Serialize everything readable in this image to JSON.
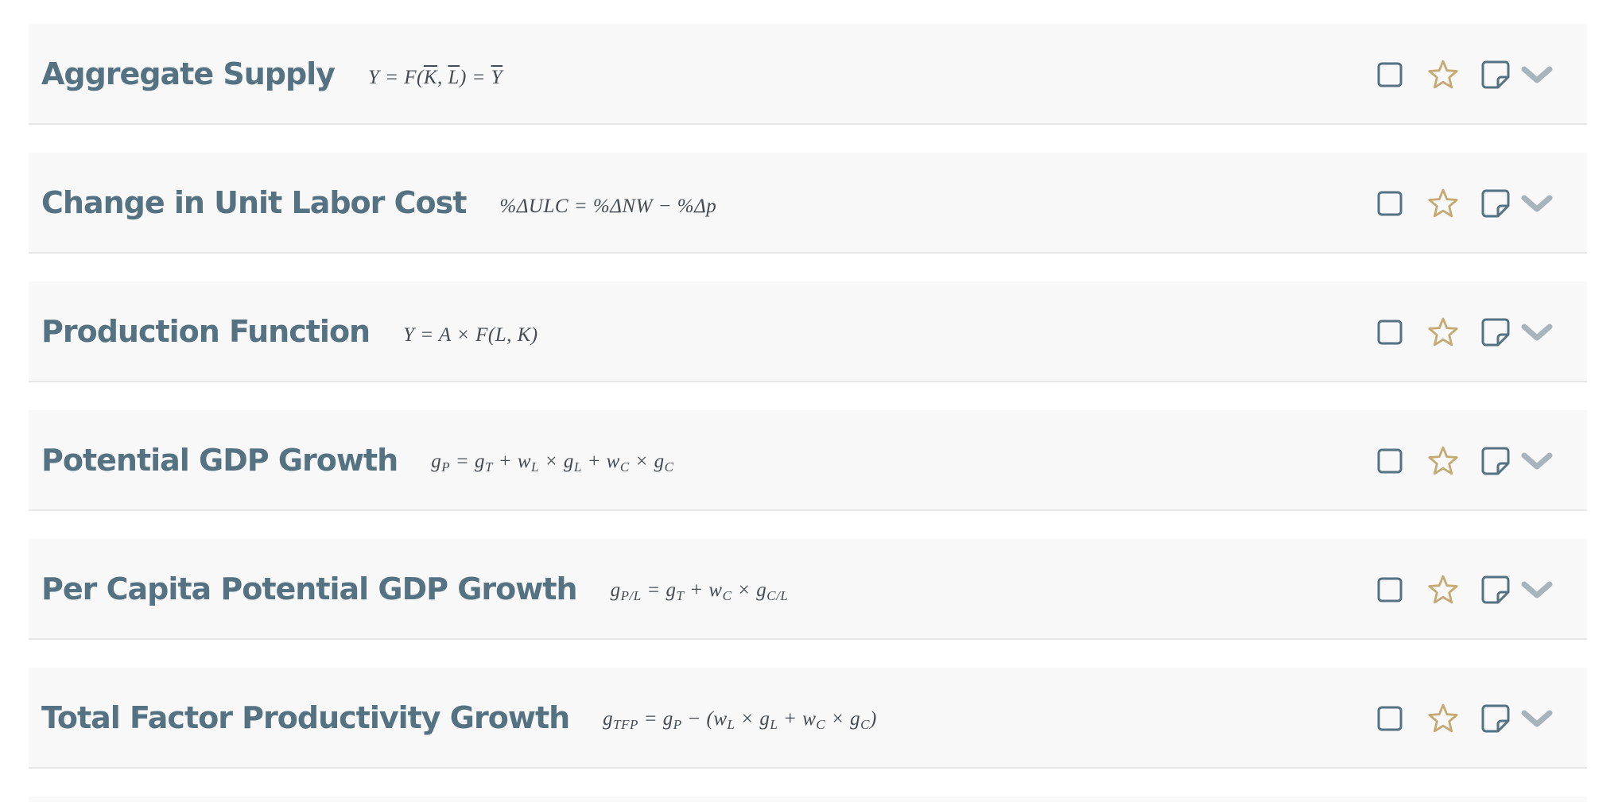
{
  "colors": {
    "title": "#557283",
    "icon_blue": "#557283",
    "star_gold": "#c4aa72",
    "chevron_grey": "#a7b4bc",
    "row_background": "#f8f8f8"
  },
  "icons": [
    "checkbox-icon",
    "star-icon",
    "sticky-note-icon",
    "chevron-down-icon"
  ],
  "formulas": [
    {
      "title": "Aggregate Supply",
      "equation": "Y = F(K̄, L̄) = Ȳ"
    },
    {
      "title": "Change in Unit Labor Cost",
      "equation": "%ΔULC = %ΔNW − %Δp"
    },
    {
      "title": "Production Function",
      "equation": "Y = A × F(L, K)"
    },
    {
      "title": "Potential GDP Growth",
      "equation": "gP = gT + wL × gL + wC × gC"
    },
    {
      "title": "Per Capita Potential GDP Growth",
      "equation": "gP/L = gT + wC × gC/L"
    },
    {
      "title": "Total Factor Productivity Growth",
      "equation": "gTFP = gP − (wL × gL + wC × gC)"
    }
  ]
}
